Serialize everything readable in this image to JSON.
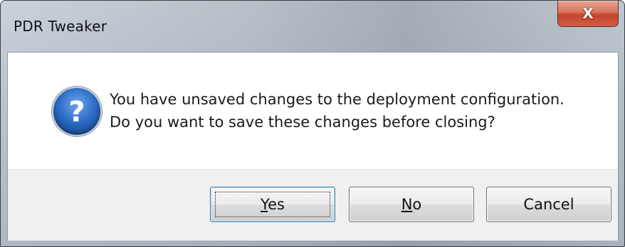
{
  "window": {
    "title": "PDR Tweaker",
    "close_label": "X"
  },
  "message": {
    "icon": "question-icon",
    "icon_glyph": "?",
    "line1": "You have unsaved changes to the deployment configuration.",
    "line2": "Do you want to save these changes before closing?"
  },
  "buttons": {
    "yes": {
      "mnemonic": "Y",
      "rest": "es"
    },
    "no": {
      "mnemonic": "N",
      "rest": "o"
    },
    "cancel": {
      "label": "Cancel"
    }
  },
  "colors": {
    "close_button": "#d9735d",
    "icon_blue": "#2f6fc9",
    "button_area": "#f0f0f0"
  }
}
